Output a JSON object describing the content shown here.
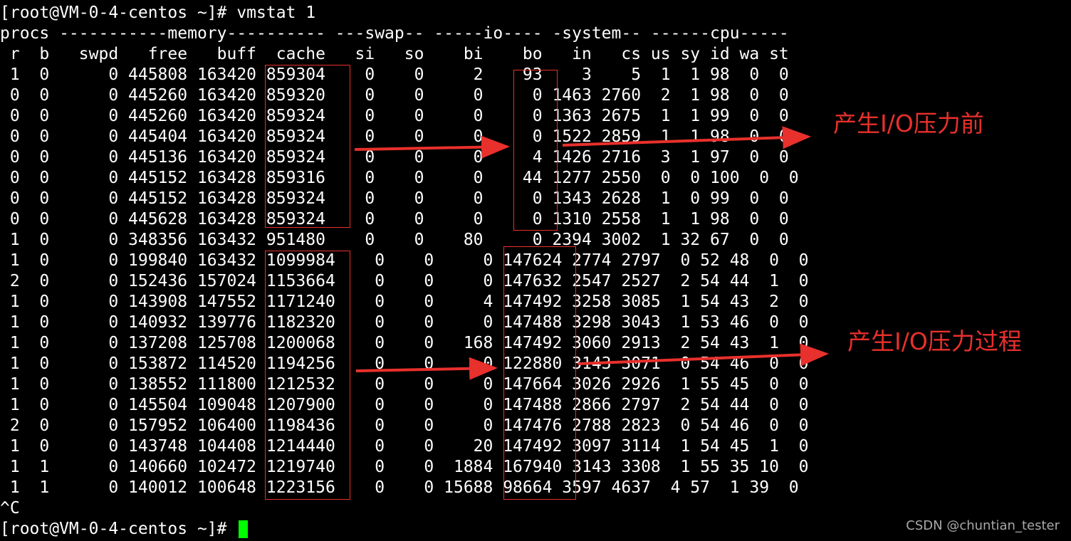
{
  "terminal": {
    "prompt_command": "[root@VM-0-4-centos ~]# vmstat 1",
    "header_groups": "procs -----------memory---------- ---swap-- -----io---- -system-- ------cpu-----",
    "header_columns": " r  b   swpd   free   buff  cache   si   so    bi    bo   in   cs us sy id wa st",
    "rows": [
      " 1  0      0 445808 163420 859304    0    0     2    93    3    5  1  1 98  0  0",
      " 0  0      0 445260 163420 859320    0    0     0     0 1463 2760  2  1 98  0  0",
      " 0  0      0 445260 163420 859324    0    0     0     0 1363 2675  1  1 99  0  0",
      " 0  0      0 445404 163420 859324    0    0     0     0 1522 2859  1  1 98  0  0",
      " 0  0      0 445136 163420 859324    0    0     0     4 1426 2716  3  1 97  0  0",
      " 0  0      0 445152 163428 859316    0    0     0    44 1277 2550  0  0 100  0  0",
      " 0  0      0 445152 163428 859324    0    0     0     0 1343 2628  1  0 99  0  0",
      " 0  0      0 445628 163428 859324    0    0     0     0 1310 2558  1  1 98  0  0",
      " 1  0      0 348356 163432 951480    0    0    80     0 2394 3002  1 32 67  0  0",
      " 1  0      0 199840 163432 1099984    0    0     0 147624 2774 2797  0 52 48  0  0",
      " 2  0      0 152436 157024 1153664    0    0     0 147632 2547 2527  2 54 44  1  0",
      " 1  0      0 143908 147552 1171240    0    0     4 147492 3258 3085  1 54 43  2  0",
      " 1  0      0 140932 139776 1182320    0    0     0 147488 3298 3043  1 53 46  0  0",
      " 1  0      0 137208 125708 1200068    0    0   168 147492 3060 2913  2 54 43  1  0",
      " 1  0      0 153872 114520 1194256    0    0     0 122880 3143 3071  0 54 46  0  0",
      " 1  0      0 138552 111800 1212532    0    0     0 147664 3026 2926  1 55 45  0  0",
      " 1  0      0 145504 109048 1207900    0    0     0 147488 2866 2797  2 54 44  0  0",
      " 2  0      0 157952 106400 1198436    0    0     0 147476 2788 2823  0 54 46  0  0",
      " 1  0      0 143748 104408 1214440    0    0    20 147492 3097 3114  1 54 45  1  0",
      " 1  1      0 140660 102472 1219740    0    0  1884 167940 3143 3308  1 55 35 10  0",
      " 1  1      0 140012 100648 1223156    0    0 15688 98664 3597 4637  4 57  1 39  0"
    ],
    "interrupt": "^C",
    "final_prompt": "[root@VM-0-4-centos ~]# "
  },
  "annotations": {
    "before_label": "产生I/O压力前",
    "during_label": "产生I/O压力过程"
  },
  "watermark": "CSDN @chuntian_tester",
  "colors": {
    "background": "#000000",
    "text": "#ffffff",
    "cursor": "#00ff00",
    "annotation": "#e8302c",
    "watermark": "#a8a8a8"
  }
}
